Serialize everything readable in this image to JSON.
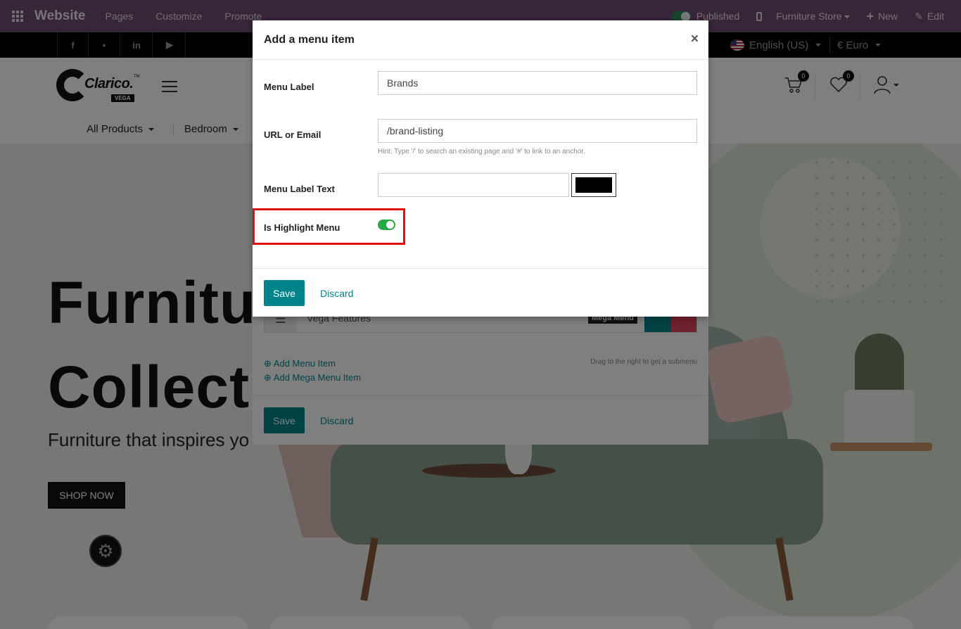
{
  "odoo_bar": {
    "brand": "Website",
    "menus": [
      "Pages",
      "Customize",
      "Promote"
    ],
    "published_label": "Published",
    "website_switcher": "Furniture Store",
    "new_label": "New",
    "edit_label": "Edit"
  },
  "social": {
    "facebook": "f",
    "twitter": "•",
    "linkedin": "in",
    "youtube": "▶",
    "language": "English (US)",
    "currency": "€ Euro"
  },
  "header": {
    "logo_text": "Clarico.",
    "logo_tm": "TM",
    "logo_sub": "VEGA",
    "cart_count": "0",
    "wishlist_count": "0"
  },
  "categories": [
    "All Products",
    "Bedroom"
  ],
  "hero": {
    "title_line1": "Furnitu",
    "title_line2": "Collect",
    "subtitle": "Furniture that inspires yo",
    "cta": "SHOP NOW"
  },
  "bg_modal": {
    "row_label": "Vega Features",
    "mega_tag": "Mega Menu",
    "add_menu_item": "Add Menu Item",
    "add_mega_menu_item": "Add Mega Menu Item",
    "hint": "Drag to the right to get a submenu",
    "save": "Save",
    "discard": "Discard"
  },
  "modal": {
    "title": "Add a menu item",
    "close": "×",
    "menu_label_label": "Menu Label",
    "menu_label_value": "Brands",
    "url_label": "URL or Email",
    "url_value": "/brand-listing",
    "url_hint": "Hint: Type '/' to search an existing page and '#' to link to an anchor.",
    "label_text_label": "Menu Label Text",
    "label_text_value": "",
    "label_text_color": "#000000",
    "highlight_label": "Is Highlight Menu",
    "highlight_on": true,
    "save": "Save",
    "discard": "Discard"
  },
  "colors": {
    "odoo_bar": "#6f4a70",
    "primary": "#00848a",
    "highlight_outline": "#e01010",
    "toggle_on": "#28a745"
  }
}
